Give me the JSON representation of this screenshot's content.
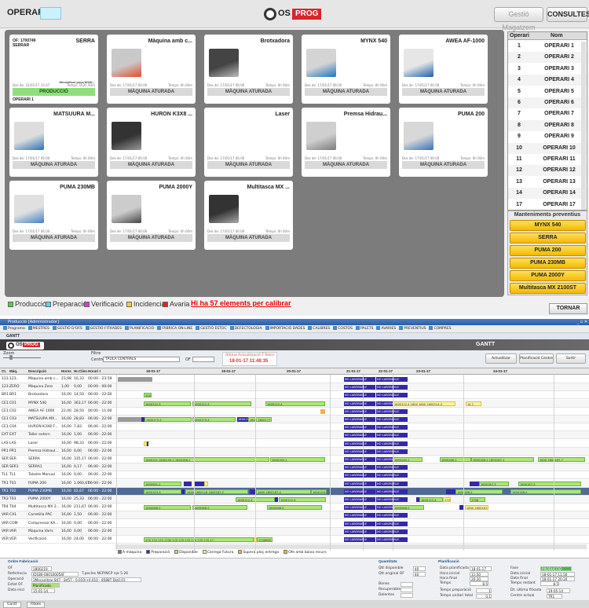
{
  "top": {
    "operari_label": "OPERARI",
    "logo_text": "OS",
    "logo_accent": "PROG",
    "btn_gestio": "Gestió Magatzem",
    "btn_consultes": "CONSULTES",
    "machines": [
      {
        "name": "SERRA",
        "of": "OF: 1700749",
        "of2": "SERRAR",
        "fab": "Mecanitzar peça M100...",
        "dates_l": "Des de: 22/01/17 15:47",
        "dates_r": "Temps: 1h2h 40m",
        "status": "PRODUCCIÓ",
        "operator": "OPERARI 1"
      },
      {
        "name": "Màquina amb c...",
        "dates_l": "Des de: 17/01/17 06:00",
        "dates_r": "Temps: 0h 00m",
        "status": "MÀQUINA ATURADA"
      },
      {
        "name": "Brotxadora",
        "dates_l": "Des de: 17/01/17 06:00",
        "dates_r": "Temps: 0h 00m",
        "status": "MÀQUINA ATURADA"
      },
      {
        "name": "MYNX 540",
        "dates_l": "Des de: 17/01/17 06:00",
        "dates_r": "Temps: 0h 00m",
        "status": "MÀQUINA ATURADA"
      },
      {
        "name": "AWEA AF-1000",
        "dates_l": "Des de: 17/01/17 06:00",
        "dates_r": "Temps: 0h 00m",
        "status": "MÀQUINA ATURADA"
      },
      {
        "name": "MATSUURA M...",
        "dates_l": "Des de: 17/01/17 06:00",
        "dates_r": "Temps: 0h 00m",
        "status": "MÀQUINA ATURADA"
      },
      {
        "name": "HURON K3X8 ...",
        "dates_l": "Des de: 17/01/17 06:00",
        "dates_r": "Temps: 0h 00m",
        "status": "MÀQUINA ATURADA"
      },
      {
        "name": "Laser",
        "dates_l": "Des de: 17/01/17 06:00",
        "dates_r": "Temps: 0h 00m",
        "status": "MÀQUINA ATURADA"
      },
      {
        "name": "Premsa Hidrau...",
        "dates_l": "Des de: 17/01/17 06:00",
        "dates_r": "Temps: 0h 00m",
        "status": "MÀQUINA ATURADA"
      },
      {
        "name": "PUMA 200",
        "dates_l": "Des de: 17/01/17 06:00",
        "dates_r": "Temps: 0h 00m",
        "status": "MÀQUINA ATURADA"
      },
      {
        "name": "PUMA 230MB",
        "dates_l": "Des de: 17/01/17 06:00",
        "dates_r": "Temps: 0h 00m",
        "status": "MÀQUINA ATURADA"
      },
      {
        "name": "PUMA 2000Y",
        "dates_l": "Des de: 17/01/17 06:00",
        "dates_r": "Temps: 0h 00m",
        "status": "MÀQUINA ATURADA"
      },
      {
        "name": "Multitasca MX ...",
        "dates_l": "Des de: 17/01/17 06:00",
        "dates_r": "Temps: 0h 00m",
        "status": "MÀQUINA ATURADA"
      }
    ],
    "operaris_head": {
      "col1": "Operari",
      "col2": "Nom"
    },
    "operaris": [
      {
        "n": "1",
        "m": "OPERARI 1"
      },
      {
        "n": "2",
        "m": "OPERARI 2"
      },
      {
        "n": "3",
        "m": "OPERARI 3"
      },
      {
        "n": "4",
        "m": "OPERARI 4"
      },
      {
        "n": "5",
        "m": "OPERARI 5"
      },
      {
        "n": "6",
        "m": "OPERARI 6"
      },
      {
        "n": "7",
        "m": "OPERARI 7"
      },
      {
        "n": "8",
        "m": "OPERARI 8"
      },
      {
        "n": "9",
        "m": "OPERARI 9"
      },
      {
        "n": "10",
        "m": "OPERARI 10"
      },
      {
        "n": "11",
        "m": "OPERARI 11"
      },
      {
        "n": "12",
        "m": "OPERARI 12"
      },
      {
        "n": "13",
        "m": "OPERARI 13"
      },
      {
        "n": "14",
        "m": "OPERARI 14"
      },
      {
        "n": "17",
        "m": "OPERARI 17"
      }
    ],
    "mant_title": "Manteniments preventius",
    "mant": [
      "MYNX 540",
      "SERRA",
      "PUMA 200",
      "PUMA 230MB",
      "PUMA 2000Y",
      "Multitasca MX 2100ST"
    ],
    "legend": [
      {
        "label": "Producció",
        "color": "#4bd14b"
      },
      {
        "label": "Preparació",
        "color": "#55d6f0"
      },
      {
        "label": "Verificació",
        "color": "#d23bd8"
      },
      {
        "label": "Incidencia",
        "color": "#f2d23a"
      },
      {
        "label": "Avaria",
        "color": "#e02020"
      }
    ],
    "calibrar": "Hi ha 57 elements per calibrar",
    "btn_tornar": "TORNAR"
  },
  "bottom": {
    "window_title": "Producció [Administrador]",
    "menu": [
      "Programa",
      "MESTRES",
      "GESTIÓ D'OFS",
      "GESTIÓ FITXADES",
      "PLANIFICACIÓ",
      "FÀBRICA ON-LINE",
      "GESTIÓ ESTOC",
      "DEFECTOLOGIA",
      "IMPORTACIÓ DADES",
      "CALIBRES",
      "COSTOS",
      "PALETS",
      "AVARIES",
      "PREVENTIUS",
      "COMPRES"
    ],
    "subtitle": "GANTT",
    "gantt_title": "GANTT",
    "zoom_label": "Zoom",
    "filtre_label": "Filtre",
    "centre_label": "Centre",
    "centre_value": "TAULA CENTRALS",
    "of_label": "OF",
    "ultima_label": "Última Actualització T.Teòric",
    "ultima_value": "18-01-17 11:48:35",
    "btn_actualitzar": "Actualitzar",
    "btn_planificacio": "Planificació Centre",
    "btn_sortir": "Sortir",
    "columns": [
      "Ct.",
      "Màq.",
      "Descripció",
      "Hores",
      "Hr.Clien",
      "Horari t"
    ],
    "dates": [
      "18-01-17",
      "19-01-17",
      "20-01-17",
      "21-01-17",
      "22-01-17",
      "23-01-17",
      "24-01-17"
    ],
    "rows": [
      {
        "ct": "123..",
        "maq": "123..",
        "desc": "Màquina amb c...",
        "hores": "23,98",
        "hrc": "16,33",
        "hor": "00:00 - 23:59"
      },
      {
        "ct": "123..",
        "maq": "ZERO",
        "desc": "Màquina Zero",
        "hores": "1,00",
        "hrc": "0,00",
        "hor": "00:00 - 00:00"
      },
      {
        "ct": "BR1",
        "maq": "BR1",
        "desc": "Brotxadora",
        "hores": "16,00",
        "hrc": "14,50",
        "hor": "06:00 - 22:00"
      },
      {
        "ct": "CE1",
        "maq": "C01",
        "desc": "MYNX 540",
        "hores": "16,00",
        "hrc": "363,17",
        "hor": "06:00 - 22:00"
      },
      {
        "ct": "CE1",
        "maq": "C02",
        "desc": "AWEA AF-1000",
        "hores": "22,00",
        "hrc": "28,50",
        "hor": "00:00 - 11:00"
      },
      {
        "ct": "CE1",
        "maq": "C03",
        "desc": "MATSUURA MX...",
        "hores": "16,00",
        "hrc": "28,83",
        "hor": "06:00 - 22:00"
      },
      {
        "ct": "CE1",
        "maq": "C04",
        "desc": "HURON K3X8 F...",
        "hores": "16,00",
        "hrc": "7,83",
        "hor": "06:00 - 22:00"
      },
      {
        "ct": "EXT",
        "maq": "EXT",
        "desc": "Taller extern",
        "hores": "16,00",
        "hrc": "1,00",
        "hor": "06:00 - 22:00"
      },
      {
        "ct": "LAS",
        "maq": "LAS",
        "desc": "Laser",
        "hores": "16,00",
        "hrc": "98,33",
        "hor": "06:00 - 22:00"
      },
      {
        "ct": "PR1",
        "maq": "PR1",
        "desc": "Premsa Hidraul...",
        "hores": "16,00",
        "hrc": "0,00",
        "hor": "06:00 - 22:00"
      },
      {
        "ct": "SER",
        "maq": "SER",
        "desc": "SERRA",
        "hores": "16,00",
        "hrc": "335,17",
        "hor": "06:00 - 22:00"
      },
      {
        "ct": "SER",
        "maq": "SER1",
        "desc": "SERRA1",
        "hores": "16,00",
        "hrc": "0,17",
        "hor": "06:00 - 22:00"
      },
      {
        "ct": "TL1",
        "maq": "TL1",
        "desc": "Taladre Manual",
        "hores": "16,00",
        "hrc": "0,00",
        "hor": "06:00 - 22:00"
      },
      {
        "ct": "TR1",
        "maq": "T01",
        "desc": "PUMA 200",
        "hores": "16,00",
        "hrc": "1.060,67",
        "hor": "06:00 - 22:00"
      },
      {
        "ct": "TR1",
        "maq": "T02",
        "desc": "PUMA 230MB",
        "hores": "16,00",
        "hrc": "82,67",
        "hor": "06:00 - 22:00"
      },
      {
        "ct": "TR3",
        "maq": "T03",
        "desc": "PUMA 2000Y",
        "hores": "16,00",
        "hrc": "25,33",
        "hor": "06:00 - 22:00"
      },
      {
        "ct": "TR4",
        "maq": "T04",
        "desc": "Multitasca MX 2...",
        "hores": "16,00",
        "hrc": "211,67",
        "hor": "06:00 - 22:00"
      },
      {
        "ct": "VAR",
        "maq": "CA1",
        "desc": "Carretilla PAC",
        "hores": "16,00",
        "hrc": "1,50",
        "hor": "06:00 - 22:00"
      },
      {
        "ct": "VAR",
        "maq": "COM",
        "desc": "Compressor KA...",
        "hores": "16,00",
        "hrc": "0,00",
        "hor": "06:00 - 22:00"
      },
      {
        "ct": "VAR",
        "maq": "VAR",
        "desc": "Maquina Varis",
        "hores": "16,00",
        "hrc": "0,00",
        "hor": "06:00 - 22:00"
      },
      {
        "ct": "VER",
        "maq": "VER",
        "desc": "Verificació",
        "hores": "16,00",
        "hrc": "24,00",
        "hor": "06:00 - 22:00"
      }
    ],
    "no_laborable": "NO LABORABLE",
    "gantt_legend": [
      {
        "label": "A màquina",
        "color": "#7a7a7a"
      },
      {
        "label": "Preparació",
        "color": "#3427a9"
      },
      {
        "label": "Disponible",
        "color": "#a9e67a"
      },
      {
        "label": "Càrrega Futura",
        "color": "#fbf39a"
      },
      {
        "label": "Supera plaç entrega",
        "color": "#f6b04d"
      },
      {
        "label": "Ofe amb baixa recurs",
        "color": "#e0c43a"
      }
    ],
    "ordre": {
      "title": "Ordre Fabricació",
      "of_label": "OF",
      "of_value": "1800219",
      "ref_label": "Referència",
      "ref_value": "ID180-000100054F",
      "ref_desc": "T.pecles NCP/NCP eje 5.26",
      "op_label": "Operació",
      "op_value": "3Mecanitzar 847 - 8457 - 0,010/+0,010 - 8588T Diz0,01",
      "estat_label": "Estat OF",
      "estat_value": "Planificada",
      "data_label": "Data inici",
      "data_value": "15-01-14"
    },
    "quant": {
      "title": "Quantitats",
      "disp_label": "Qtt disponible",
      "disp_value": "40",
      "orig_label": "Qtt original OF",
      "orig_value": "40",
      "bones_label": "Bones",
      "recup_label": "Recuperables",
      "def_label": "Dolentes"
    },
    "planif": {
      "title": "Planificació",
      "dp_label": "Data planificada",
      "dp_value": "18-01-17",
      "hi_label": "Hora inicial",
      "hi_value": "11:50",
      "hf_label": "Hora final",
      "hf_value": "20:20",
      "t_label": "Temps",
      "t_value": "8,5",
      "tp_label": "Temps preparació",
      "tp_value": "1",
      "tu_label": "Temps unitari total",
      "tu_value": "0,1"
    },
    "estat": {
      "fase_label": "Fase",
      "fase_value": "PRODUCCIÓ",
      "di_label": "Data inicial",
      "di_value": "18-01-17 11:50",
      "df_label": "Data final",
      "df_value": "18-01-17 20:20",
      "tr_label": "Temps restant",
      "tr_value": "8,5",
      "dum_label": "Dt. última fitxada",
      "dum_value": "19-05-14",
      "ca_label": "Centre actual",
      "ca_value": "TR1"
    },
    "tabs": [
      "Gantt",
      "Fitxes"
    ]
  }
}
